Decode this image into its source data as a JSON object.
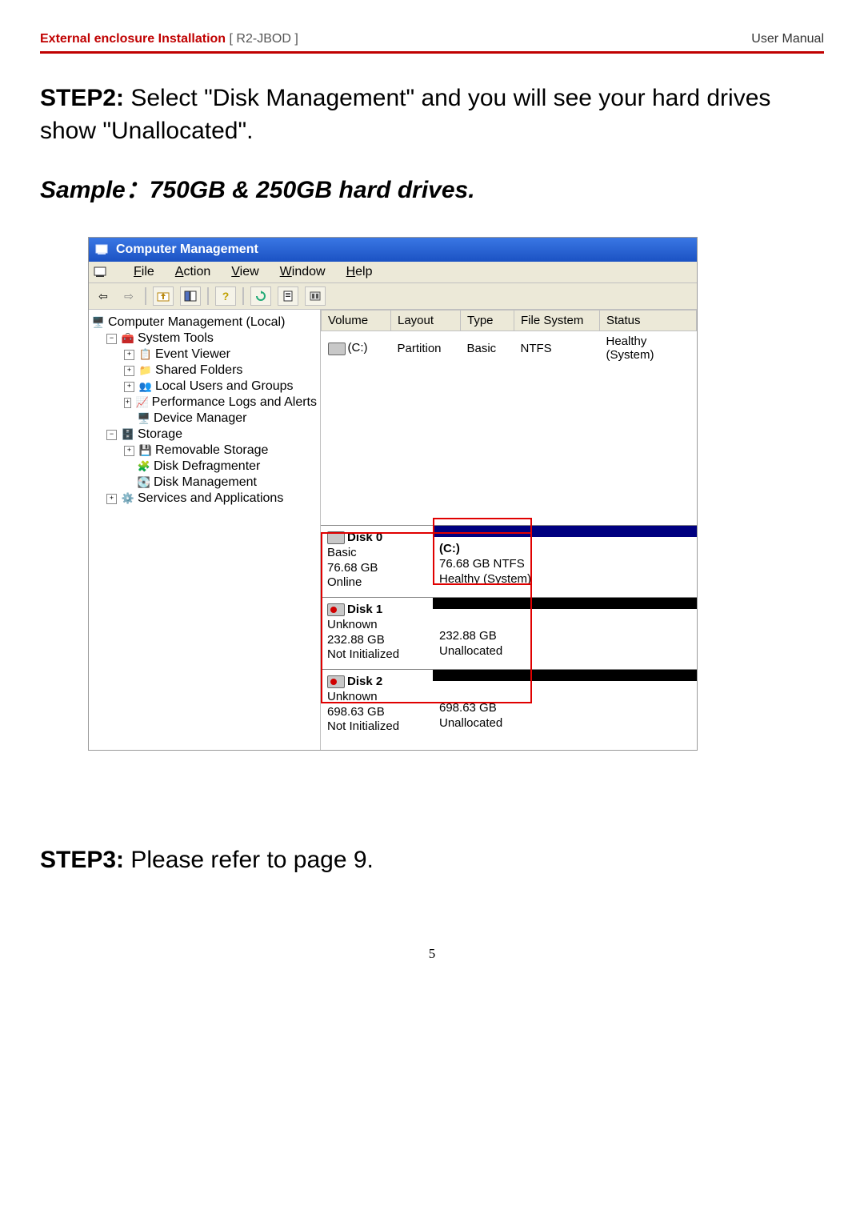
{
  "header": {
    "left_red": "External enclosure Installation",
    "left_gray": " [ R2-JBOD ]",
    "right": "User Manual"
  },
  "step2": {
    "label": "STEP2:",
    "text": " Select \"Disk Management\" and you will see your hard drives show \"Unallocated\"."
  },
  "sample": "Sample：750GB & 250GB hard drives.",
  "window": {
    "title": "Computer Management",
    "menus": {
      "file": "File",
      "action": "Action",
      "view": "View",
      "window": "Window",
      "help": "Help"
    },
    "tree": {
      "root": "Computer Management (Local)",
      "systools": "System Tools",
      "eventviewer": "Event Viewer",
      "sharedfolders": "Shared Folders",
      "localusers": "Local Users and Groups",
      "perflogs": "Performance Logs and Alerts",
      "devmgr": "Device Manager",
      "storage": "Storage",
      "removable": "Removable Storage",
      "defrag": "Disk Defragmenter",
      "diskmgmt": "Disk Management",
      "services": "Services and Applications"
    },
    "volheaders": {
      "volume": "Volume",
      "layout": "Layout",
      "type": "Type",
      "fs": "File System",
      "status": "Status"
    },
    "volrow": {
      "volume": "(C:)",
      "layout": "Partition",
      "type": "Basic",
      "fs": "NTFS",
      "status": "Healthy (System)"
    },
    "disks": [
      {
        "name": "Disk 0",
        "l1": "Basic",
        "l2": "76.68 GB",
        "l3": "Online",
        "v1": "(C:)",
        "v2": "76.68 GB NTFS",
        "v3": "Healthy (System)"
      },
      {
        "name": "Disk 1",
        "l1": "Unknown",
        "l2": "232.88 GB",
        "l3": "Not Initialized",
        "v1": "",
        "v2": "232.88 GB",
        "v3": "Unallocated"
      },
      {
        "name": "Disk 2",
        "l1": "Unknown",
        "l2": "698.63 GB",
        "l3": "Not Initialized",
        "v1": "",
        "v2": "698.63 GB",
        "v3": "Unallocated"
      }
    ]
  },
  "step3": {
    "label": "STEP3:",
    "text": " Please refer to page 9."
  },
  "page_num": "5"
}
